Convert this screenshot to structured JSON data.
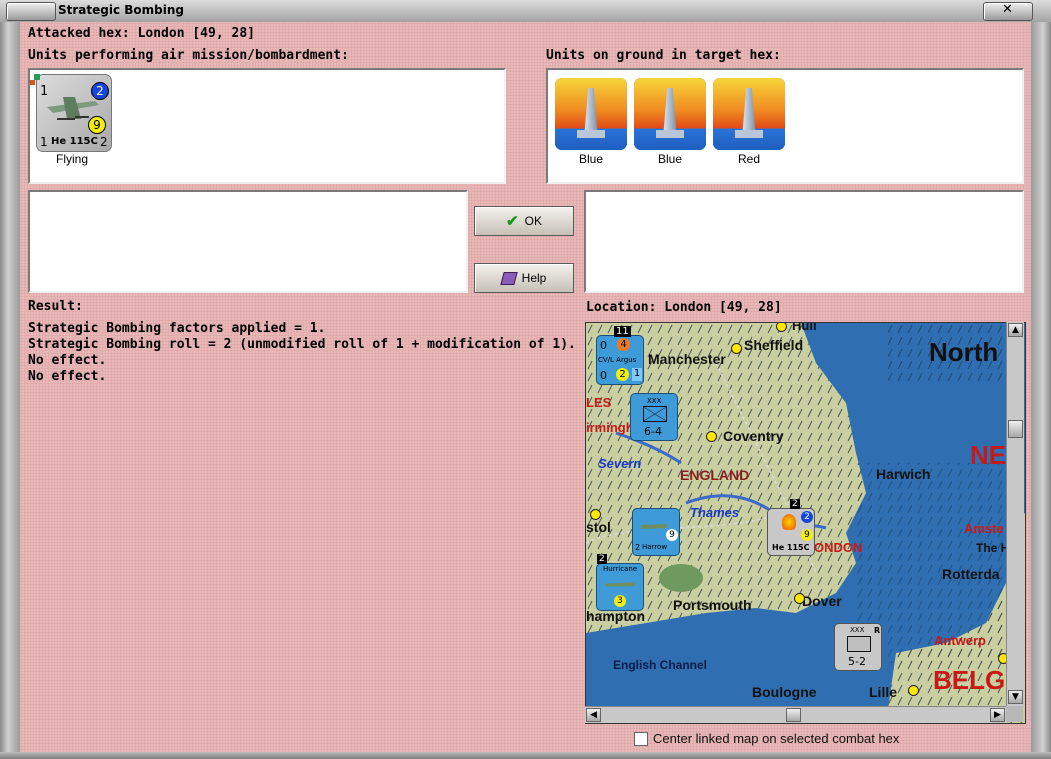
{
  "window": {
    "title": "Strategic Bombing"
  },
  "header": {
    "attacked_hex": "Attacked hex: London  [49, 28]"
  },
  "air_units": {
    "label": "Units performing air mission/bombardment:",
    "items": [
      {
        "name": "He 115C",
        "status": "Flying",
        "top_left": "1",
        "badge_blue": "2",
        "badge_yellow": "9",
        "bottom_left": "1",
        "bottom_right": "2"
      }
    ]
  },
  "ground_units": {
    "label": "Units on ground in target hex:",
    "items": [
      {
        "status": "Blue"
      },
      {
        "status": "Blue"
      },
      {
        "status": "Red"
      }
    ]
  },
  "buttons": {
    "ok": "OK",
    "help": "Help"
  },
  "result": {
    "label": "Result:",
    "lines": [
      "Strategic Bombing factors applied = 1.",
      "Strategic Bombing roll = 2 (unmodified roll of 1 + modification of 1).",
      "No effect.",
      "No effect."
    ]
  },
  "location": {
    "label": "Location:  London  [49, 28]"
  },
  "map": {
    "labels": {
      "north": "North",
      "ne": "NE",
      "manchester": "Manchester",
      "sheffield": "Sheffield",
      "hull": "Hull",
      "les": "LES",
      "birming": "irmingh",
      "coventry": "Coventry",
      "severn": "Severn",
      "england": "ENGLAND",
      "harwich": "Harwich",
      "thames": "Thames",
      "bristol": "stol",
      "london": "ONDON",
      "amster": "Amste",
      "the_h": "The H",
      "rotterdam": "Rotterda",
      "portsmouth": "Portsmouth",
      "dover": "Dover",
      "hampton": "hampton",
      "antwerp": "Antwerp",
      "channel": "English Channel",
      "boulogne": "Boulogne",
      "lille": "Lille",
      "belg": "BELG"
    },
    "units": {
      "u1": {
        "top": "11",
        "a": "0",
        "b": "4",
        "c": "0",
        "d": "2",
        "e": "1",
        "name": "CV/L Argus"
      },
      "u2": {
        "top": "XXX",
        "value": "6-4"
      },
      "u3": {
        "name": "Harrow",
        "val": "9",
        "a": "2"
      },
      "u4": {
        "top": "2",
        "name": "Hurricane",
        "val": "3"
      },
      "u5": {
        "top": "2",
        "name": "He 115C",
        "a": "2",
        "b": "9"
      },
      "u6": {
        "top": "XXX",
        "side": "R",
        "value": "5-2"
      }
    },
    "colors": {
      "sea": "#2f6eb0",
      "land": "#c9cfa0"
    }
  },
  "checkbox": {
    "label": "Center linked map on selected combat hex",
    "checked": false
  }
}
